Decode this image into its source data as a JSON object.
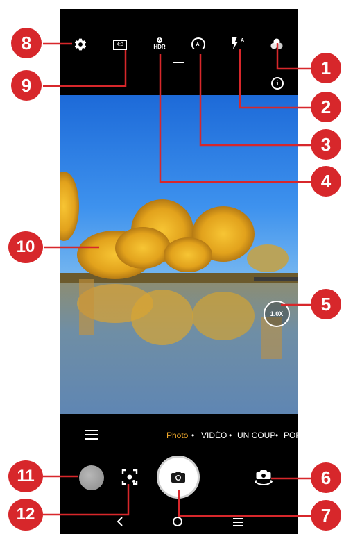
{
  "top_bar": {
    "aspect_ratio_label": "4:3",
    "hdr_label": "HDR",
    "ai_label": "AI",
    "flash_mode_label": "A"
  },
  "viewfinder": {
    "zoom_label": "1.0X"
  },
  "modes": [
    {
      "label": "Photo",
      "active": true
    },
    {
      "label": "VIDÉO",
      "active": false
    },
    {
      "label": "UN COUP",
      "active": false
    },
    {
      "label": "POR",
      "active": false
    }
  ],
  "callouts": {
    "c1": "1",
    "c2": "2",
    "c3": "3",
    "c4": "4",
    "c5": "5",
    "c6": "6",
    "c7": "7",
    "c8": "8",
    "c9": "9",
    "c10": "10",
    "c11": "11",
    "c12": "12"
  },
  "colors": {
    "accent": "#f0a92c",
    "callout": "#d7272b",
    "background": "#000000"
  },
  "icons": [
    "settings-icon",
    "aspect-ratio-icon",
    "hdr-icon",
    "ai-icon",
    "flash-icon",
    "filter-icon",
    "info-icon",
    "menu-icon",
    "lens-icon",
    "shutter-icon",
    "switch-camera-icon",
    "back-nav-icon",
    "home-nav-icon",
    "recents-nav-icon"
  ]
}
